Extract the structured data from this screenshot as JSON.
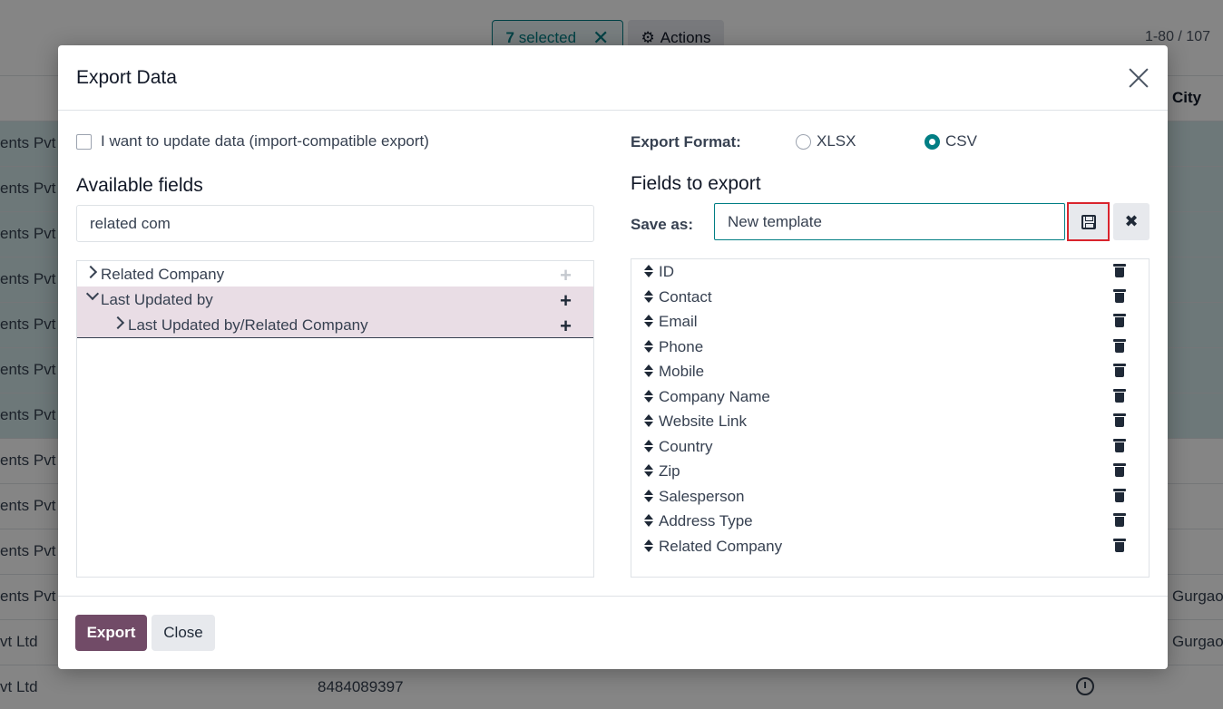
{
  "background": {
    "selected_count": "7",
    "selected_label": "selected",
    "actions_label": "Actions",
    "pager": "1-80 / 107",
    "city_header": "City",
    "rows": [
      {
        "c1": "ents Pvt L",
        "c2": "",
        "c3": ""
      },
      {
        "c1": "ents Pvt L",
        "c2": "",
        "c3": ""
      },
      {
        "c1": "ents Pvt L",
        "c2": "",
        "c3": ""
      },
      {
        "c1": "ents Pvt L",
        "c2": "",
        "c3": ""
      },
      {
        "c1": "ents Pvt L",
        "c2": "",
        "c3": ""
      },
      {
        "c1": "ents Pvt L",
        "c2": "",
        "c3": ""
      },
      {
        "c1": "ents Pvt L",
        "c2": "",
        "c3": ""
      },
      {
        "c1": "ents Pvt L",
        "c2": "",
        "c3": ""
      },
      {
        "c1": "ents Pvt L",
        "c2": "",
        "c3": ""
      },
      {
        "c1": "ents Pvt L",
        "c2": "",
        "c3": ""
      },
      {
        "c1": "ents Pvt L",
        "c2": "",
        "c3": "Gurgao"
      },
      {
        "c1": "vt Ltd",
        "c2": "",
        "c3": "Gurgao"
      },
      {
        "c1": "vt Ltd",
        "c2": "8484089397",
        "c3": ""
      }
    ]
  },
  "modal": {
    "title": "Export Data",
    "import_compat_label": "I want to update data (import-compatible export)",
    "available_fields_title": "Available fields",
    "search_value": "related com",
    "tree": [
      {
        "label": "Related Company",
        "expanded": false
      },
      {
        "label": "Last Updated by",
        "expanded": true
      },
      {
        "label": "Last Updated by/Related Company",
        "expanded": false
      }
    ],
    "export_format_label": "Export Format:",
    "formats": [
      {
        "label": "XLSX",
        "selected": false
      },
      {
        "label": "CSV",
        "selected": true
      }
    ],
    "fields_to_export_title": "Fields to export",
    "save_as_label": "Save as:",
    "template_value": "New template",
    "fields": [
      "ID",
      "Contact",
      "Email",
      "Phone",
      "Mobile",
      "Company Name",
      "Website Link",
      "Country",
      "Zip",
      "Salesperson",
      "Address Type",
      "Related Company"
    ],
    "export_button": "Export",
    "close_button": "Close"
  },
  "colors": {
    "primary": "#714b67",
    "accent": "#017e84",
    "highlight": "#e9dde5",
    "save_border": "#d9242d"
  }
}
